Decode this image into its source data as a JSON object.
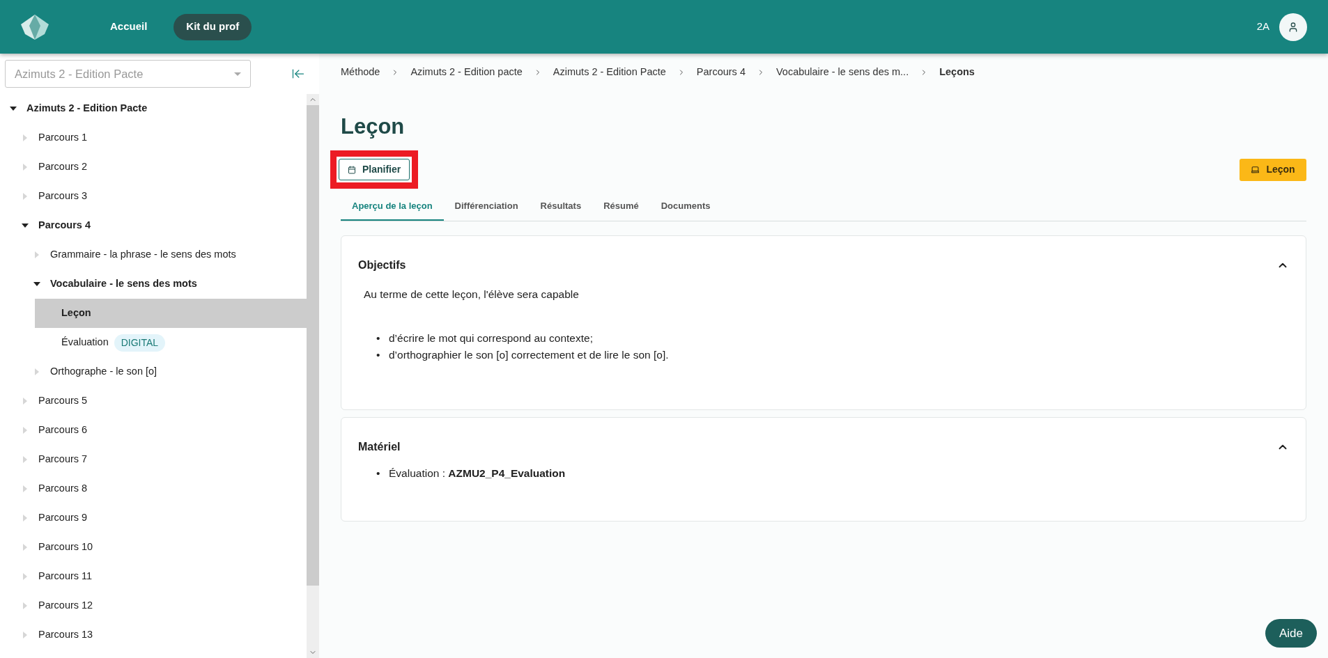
{
  "header": {
    "nav": [
      {
        "label": "Accueil",
        "selected": false
      },
      {
        "label": "Kit du prof",
        "selected": true
      }
    ],
    "user_code": "2A"
  },
  "sidebar": {
    "select": {
      "value": "Azimuts 2 - Edition Pacte"
    },
    "tree": [
      {
        "label": "Azimuts 2 - Edition Pacte",
        "kind": "branch",
        "expanded": true,
        "selected": false,
        "children": [
          {
            "label": "Parcours 1",
            "kind": "branch",
            "expanded": false,
            "selected": false
          },
          {
            "label": "Parcours 2",
            "kind": "branch",
            "expanded": false,
            "selected": false
          },
          {
            "label": "Parcours 3",
            "kind": "branch",
            "expanded": false,
            "selected": false
          },
          {
            "label": "Parcours 4",
            "kind": "branch",
            "expanded": true,
            "selected": false,
            "children": [
              {
                "label": "Grammaire - la phrase - le sens des mots",
                "kind": "branch",
                "expanded": false,
                "selected": false
              },
              {
                "label": "Vocabulaire - le sens des mots",
                "kind": "branch",
                "expanded": true,
                "selected": false,
                "children": [
                  {
                    "label": "Leçon",
                    "kind": "leaf",
                    "selected": true
                  },
                  {
                    "label": "Évaluation",
                    "kind": "leaf",
                    "selected": false,
                    "badge": "DIGITAL"
                  }
                ]
              },
              {
                "label": "Orthographe - le son [o]",
                "kind": "branch",
                "expanded": false,
                "selected": false
              }
            ]
          },
          {
            "label": "Parcours 5",
            "kind": "branch",
            "expanded": false,
            "selected": false
          },
          {
            "label": "Parcours 6",
            "kind": "branch",
            "expanded": false,
            "selected": false
          },
          {
            "label": "Parcours 7",
            "kind": "branch",
            "expanded": false,
            "selected": false
          },
          {
            "label": "Parcours 8",
            "kind": "branch",
            "expanded": false,
            "selected": false
          },
          {
            "label": "Parcours 9",
            "kind": "branch",
            "expanded": false,
            "selected": false
          },
          {
            "label": "Parcours 10",
            "kind": "branch",
            "expanded": false,
            "selected": false
          },
          {
            "label": "Parcours 11",
            "kind": "branch",
            "expanded": false,
            "selected": false
          },
          {
            "label": "Parcours 12",
            "kind": "branch",
            "expanded": false,
            "selected": false
          },
          {
            "label": "Parcours 13",
            "kind": "branch",
            "expanded": false,
            "selected": false
          }
        ]
      }
    ]
  },
  "breadcrumb": [
    "Méthode",
    "Azimuts 2 - Edition pacte",
    "Azimuts 2 - Edition Pacte",
    "Parcours 4",
    "Vocabulaire - le sens des m...",
    "Leçons"
  ],
  "page": {
    "title": "Leçon",
    "plan_button": "Planifier",
    "plan_highlighted": true,
    "lesson_button": "Leçon",
    "tabs": [
      {
        "label": "Aperçu de la leçon",
        "selected": true
      },
      {
        "label": "Différenciation",
        "selected": false
      },
      {
        "label": "Résultats",
        "selected": false
      },
      {
        "label": "Résumé",
        "selected": false
      },
      {
        "label": "Documents",
        "selected": false
      }
    ],
    "sections": [
      {
        "title": "Objectifs",
        "expanded": true,
        "bullet": "•",
        "intro": "Au terme de cette leçon, l'élève sera capable",
        "items": [
          "d’écrire le mot qui correspond au contexte;",
          "d’orthographier le son [o] correctement et de lire le son [o]."
        ]
      },
      {
        "title": "Matériel",
        "expanded": true,
        "bullet": "•",
        "items": [
          "Évaluation : **AZMU2_P4_Evaluation**"
        ]
      }
    ]
  },
  "help_button": "Aide"
}
